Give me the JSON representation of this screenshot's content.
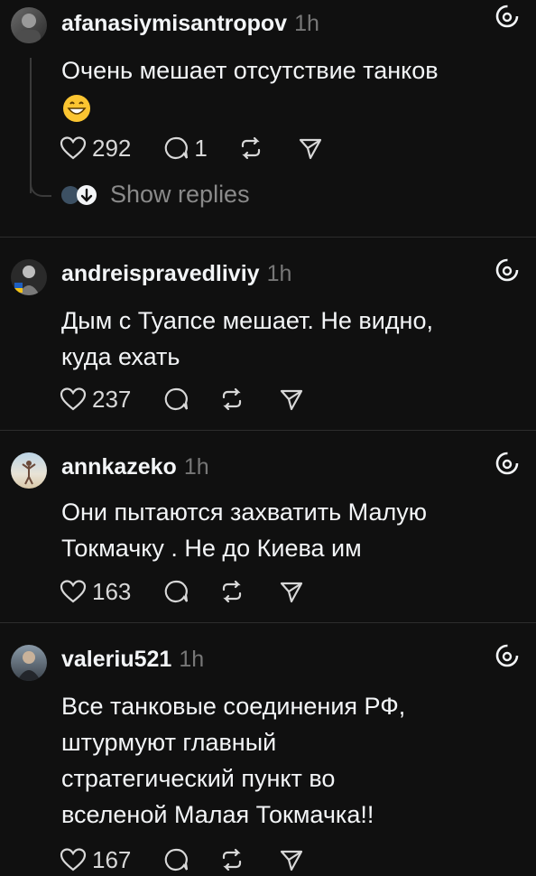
{
  "posts": [
    {
      "username": "afanasiymisantropov",
      "time": "1h",
      "text": "Очень мешает отсутствие танков",
      "emoji": "grinning-face-emoji",
      "likes": "292",
      "comments": "1",
      "show_replies": "Show replies"
    },
    {
      "username": "andreispravedliviy",
      "time": "1h",
      "text_lines": [
        "Дым с Туапсе мешает. Не видно,",
        "куда ехать"
      ],
      "likes": "237"
    },
    {
      "username": "annkazeko",
      "time": "1h",
      "text_lines": [
        "Они пытаются захватить Малую",
        "Токмачку . Не до Киева им"
      ],
      "likes": "163"
    },
    {
      "username": "valeriu521",
      "time": "1h",
      "text_lines": [
        "Все танковые соединения РФ,",
        "штурмуют главный",
        "стратегический пункт во",
        "вселеной Малая Токмачка!!"
      ],
      "likes": "167"
    }
  ],
  "icons": {
    "like": "heart-icon",
    "comment": "comment-bubble-icon",
    "repost": "repost-icon",
    "share": "send-icon",
    "threads": "threads-logo-icon"
  },
  "colors": {
    "background": "#101010",
    "text": "#f3f5f7",
    "muted": "#777777",
    "divider": "#2d2d2d"
  }
}
